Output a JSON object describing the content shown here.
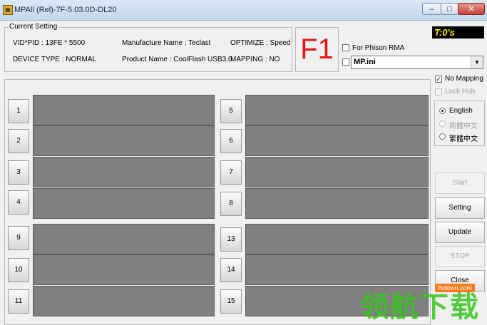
{
  "window": {
    "title": "MPAll (Rel)-7F-5.03.0D-DL20",
    "min_glyph": "–",
    "max_glyph": "□",
    "close_glyph": "✕"
  },
  "current_setting": {
    "legend": "Current Setting",
    "vid_pid": "VID*PID : 13FE * 5500",
    "device_type": "DEVICE TYPE : NORMAL",
    "manufacture_name": "Manufacture Name : Teclast",
    "product_name": "Product Name : CoolFlash USB3.0",
    "optimize": "OPTIMIZE : Speed",
    "mapping": "MAPPING : NO"
  },
  "function_key": "F1",
  "timer": "T:0's",
  "for_phison_rma": {
    "label": "For Phison RMA",
    "checked": false
  },
  "ini_file": {
    "value": "MP.ini",
    "checked": false
  },
  "no_mapping": {
    "label": "No Mapping",
    "checked": true
  },
  "lock_hub": {
    "label": "Lock Hub",
    "checked": false
  },
  "languages": [
    {
      "label": "English",
      "selected": true,
      "enabled": true
    },
    {
      "label": "简體中文",
      "selected": false,
      "enabled": false
    },
    {
      "label": "繁體中文",
      "selected": false,
      "enabled": true
    }
  ],
  "ports_left": [
    "1",
    "2",
    "3",
    "4",
    "9",
    "10",
    "11"
  ],
  "ports_right": [
    "5",
    "6",
    "7",
    "8",
    "13",
    "14",
    "15"
  ],
  "buttons": {
    "start": "Start",
    "setting": "Setting",
    "update": "Update",
    "stop": "STOP",
    "close": "Close"
  },
  "watermark": {
    "url": "lhdown.com",
    "text": "领航下载"
  }
}
